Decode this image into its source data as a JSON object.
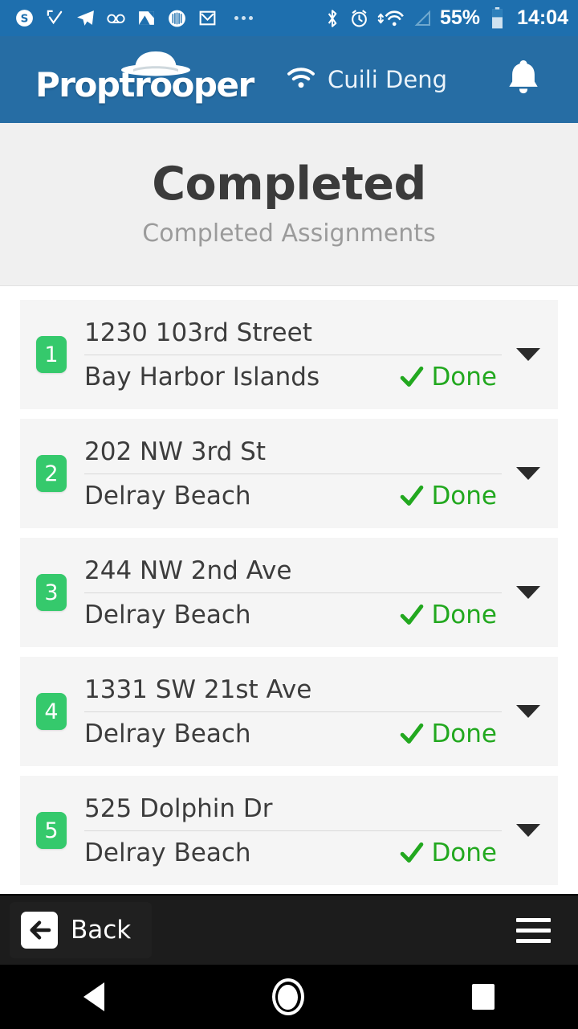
{
  "statusbar": {
    "left_icons": [
      {
        "name": "skype-icon",
        "glyph": "S"
      },
      {
        "name": "checkmark-app-icon",
        "glyph": "check"
      },
      {
        "name": "telegram-icon",
        "glyph": "paper-plane"
      },
      {
        "name": "voicemail-icon",
        "glyph": "oo"
      },
      {
        "name": "gallery-icon",
        "glyph": "photo"
      },
      {
        "name": "barcode-circle-icon",
        "glyph": "barcode"
      },
      {
        "name": "gmail-icon",
        "glyph": "M"
      }
    ],
    "overflow": "more-icons-indicator",
    "right_icons": [
      {
        "name": "bluetooth-icon"
      },
      {
        "name": "alarm-clock-icon"
      },
      {
        "name": "wifi-transfer-icon"
      },
      {
        "name": "signal-icon"
      }
    ],
    "battery_percent": "55%",
    "time": "14:04"
  },
  "appbar": {
    "brand": "Proptrooper",
    "user_name": "Cuili Deng",
    "wifi_icon": "wifi-icon",
    "bell_icon": "bell-icon"
  },
  "header": {
    "title": "Completed",
    "subtitle": "Completed Assignments"
  },
  "assignments": [
    {
      "number": "1",
      "address": "1230 103rd Street",
      "city": "Bay Harbor Islands",
      "status": "Done"
    },
    {
      "number": "2",
      "address": "202 NW 3rd St",
      "city": "Delray Beach",
      "status": "Done"
    },
    {
      "number": "3",
      "address": "244 NW 2nd Ave",
      "city": "Delray Beach",
      "status": "Done"
    },
    {
      "number": "4",
      "address": "1331 SW 21st Ave",
      "city": "Delray Beach",
      "status": "Done"
    },
    {
      "number": "5",
      "address": "525 Dolphin Dr",
      "city": "Delray Beach",
      "status": "Done"
    }
  ],
  "toolbar": {
    "back_label": "Back",
    "back_icon": "arrow-left-icon",
    "menu_icon": "hamburger-menu-icon"
  },
  "navbar": {
    "back": "nav-back-icon",
    "home": "nav-home-icon",
    "recents": "nav-recents-icon"
  },
  "colors": {
    "statusbar_blue": "#1e6fae",
    "appbar_blue": "#266da4",
    "badge_green": "#35c96c",
    "status_green": "#22a81f",
    "header_bg": "#f0f0f0",
    "card_bg": "#f5f5f5",
    "toolbar_dark": "#1c1c1c"
  }
}
